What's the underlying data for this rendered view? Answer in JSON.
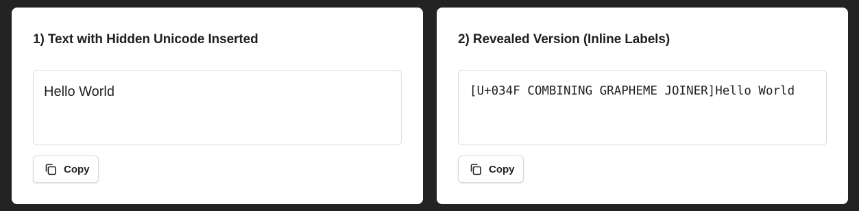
{
  "panels": [
    {
      "title": "1) Text with Hidden Unicode Inserted",
      "text": "Hello World",
      "copy_label": "Copy",
      "copy_icon": "copy-icon"
    },
    {
      "title": "2) Revealed Version (Inline Labels)",
      "text": "[U+034F COMBINING GRAPHEME JOINER]Hello World",
      "copy_label": "Copy",
      "copy_icon": "copy-icon"
    }
  ],
  "colors": {
    "background": "#232323",
    "panel": "#ffffff",
    "text": "#1f1f1f",
    "border": "#dcdcdc"
  }
}
